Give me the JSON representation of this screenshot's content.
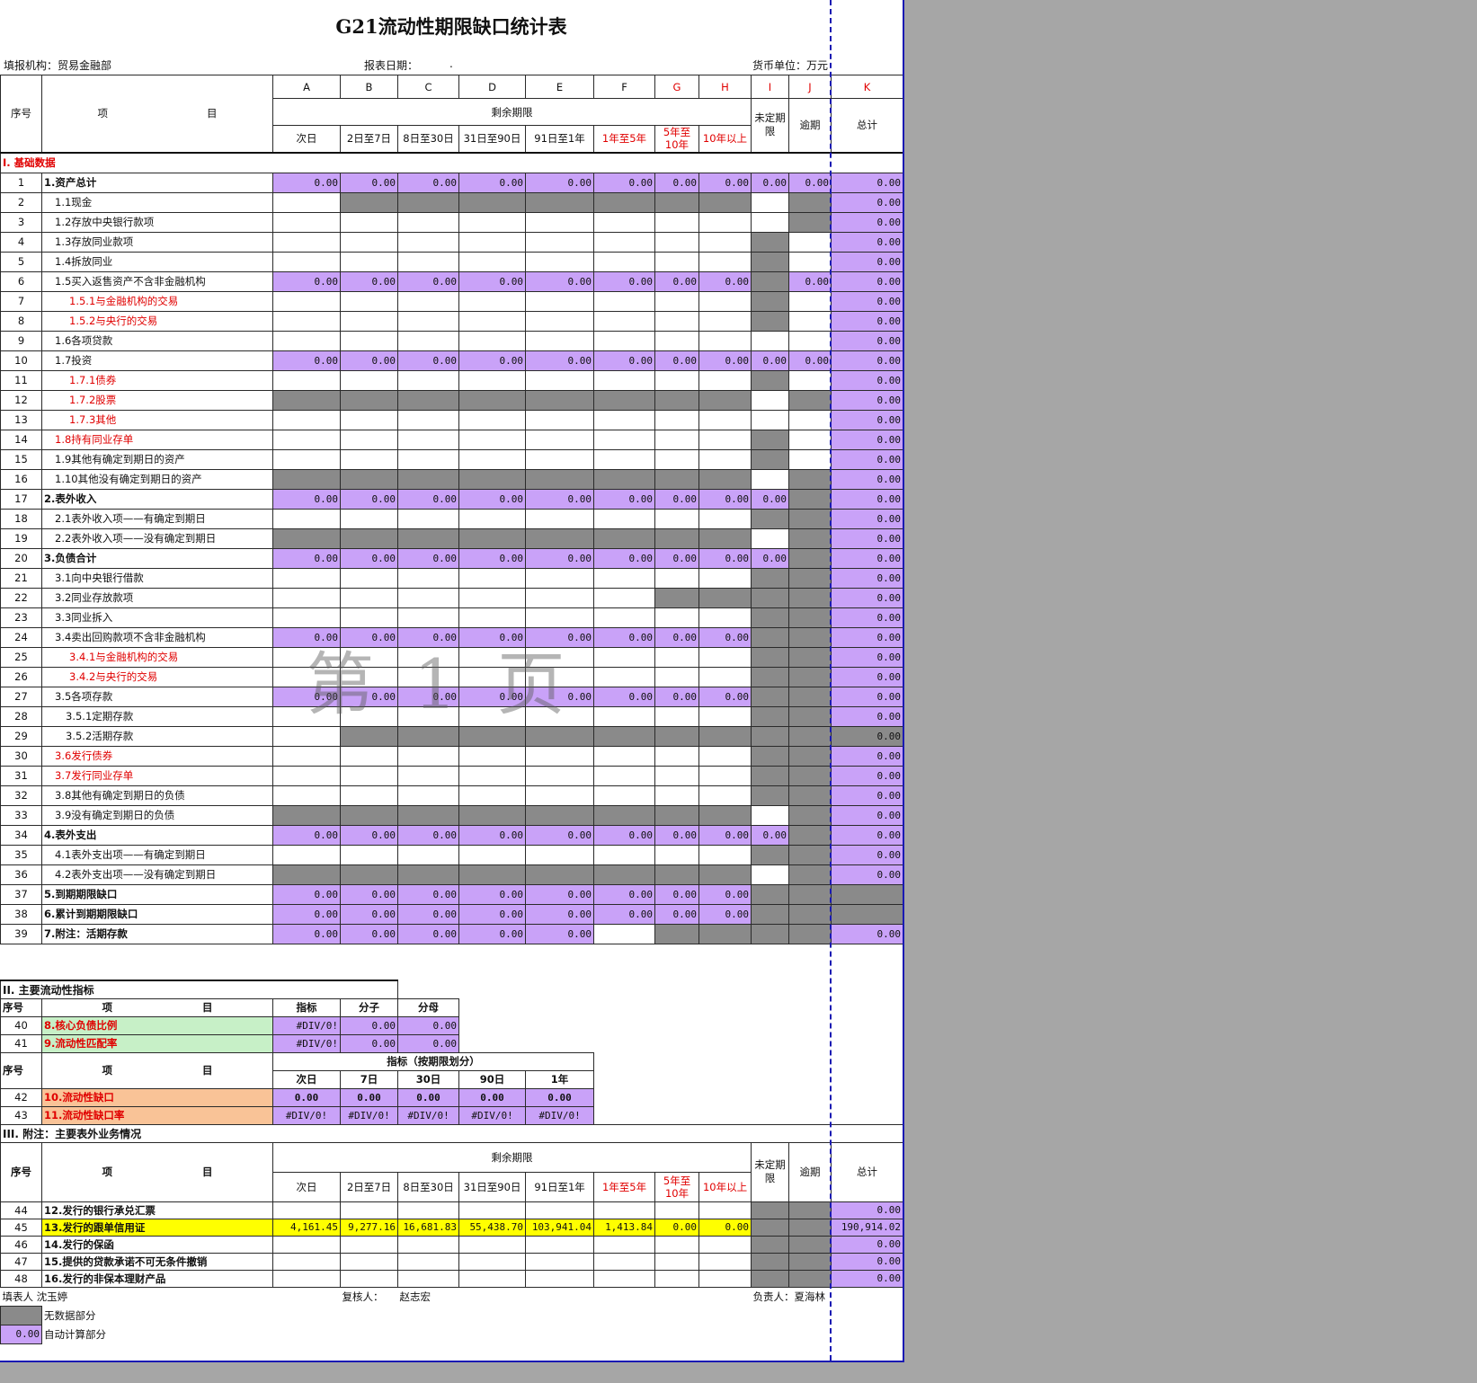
{
  "title": "G21流动性期限缺口统计表",
  "info": {
    "org_label": "填报机构：贸易金融部",
    "date_label": "报表日期：",
    "date_value": ".",
    "currency_label": "货币单位：万元"
  },
  "header": {
    "seq": "序号",
    "item_a": "项",
    "item_b": "目",
    "col_letters": [
      "A",
      "B",
      "C",
      "D",
      "E",
      "F",
      "G",
      "H",
      "I",
      "J",
      "K"
    ],
    "remaining": "剩余期限",
    "periods": [
      "次日",
      "2日至7日",
      "8日至30日",
      "31日至90日",
      "91日至1年",
      "1年至5年",
      "5年至10年",
      "10年以上"
    ],
    "undetermined": "未定期限",
    "overdue": "逾期",
    "total": "总计"
  },
  "section1": "I. 基础数据",
  "rows": [
    {
      "n": "1",
      "label": "1.资产总计",
      "style": "b",
      "fill": "pppppppppp",
      "vals": [
        "0.00",
        "0.00",
        "0.00",
        "0.00",
        "0.00",
        "0.00",
        "0.00",
        "0.00",
        "0.00",
        "0.00"
      ],
      "total": "0.00"
    },
    {
      "n": "2",
      "label": "1.1现金",
      "style": "i1",
      "fill": "wgggggggwg",
      "vals": [],
      "total": "0.00"
    },
    {
      "n": "3",
      "label": "1.2存放中央银行款项",
      "style": "i1",
      "fill": "wwwwwwwwwg",
      "vals": [],
      "total": "0.00"
    },
    {
      "n": "4",
      "label": "1.3存放同业款项",
      "style": "i1",
      "fill": "wwwwwwwwgw",
      "vals": [],
      "total": "0.00"
    },
    {
      "n": "5",
      "label": "1.4拆放同业",
      "style": "i1",
      "fill": "wwwwwwwwgw",
      "vals": [],
      "total": "0.00"
    },
    {
      "n": "6",
      "label": "1.5买入返售资产不含非金融机构",
      "style": "i1",
      "fill": "ppppppppgp",
      "vals": [
        "0.00",
        "0.00",
        "0.00",
        "0.00",
        "0.00",
        "0.00",
        "0.00",
        "0.00",
        "",
        "0.00"
      ],
      "total": "0.00"
    },
    {
      "n": "7",
      "label": "1.5.1与金融机构的交易",
      "style": "i2r",
      "fill": "wwwwwwwwgw",
      "vals": [],
      "total": "0.00"
    },
    {
      "n": "8",
      "label": "1.5.2与央行的交易",
      "style": "i2r",
      "fill": "wwwwwwwwgw",
      "vals": [],
      "total": "0.00"
    },
    {
      "n": "9",
      "label": "1.6各项贷款",
      "style": "i1",
      "fill": "wwwwwwwwww",
      "vals": [],
      "total": "0.00"
    },
    {
      "n": "10",
      "label": "1.7投资",
      "style": "i1",
      "fill": "pppppppppp",
      "vals": [
        "0.00",
        "0.00",
        "0.00",
        "0.00",
        "0.00",
        "0.00",
        "0.00",
        "0.00",
        "0.00",
        "0.00"
      ],
      "total": "0.00"
    },
    {
      "n": "11",
      "label": "1.7.1债券",
      "style": "i2r",
      "fill": "wwwwwwwwgw",
      "vals": [],
      "total": "0.00"
    },
    {
      "n": "12",
      "label": "1.7.2股票",
      "style": "i2r",
      "fill": "ggggggggwg",
      "vals": [],
      "total": "0.00"
    },
    {
      "n": "13",
      "label": "1.7.3其他",
      "style": "i2r",
      "fill": "wwwwwwwwww",
      "vals": [],
      "total": "0.00"
    },
    {
      "n": "14",
      "label": "1.8持有同业存单",
      "style": "i1r",
      "fill": "wwwwwwwwgw",
      "vals": [],
      "total": "0.00"
    },
    {
      "n": "15",
      "label": "1.9其他有确定到期日的资产",
      "style": "i1",
      "fill": "wwwwwwwwgw",
      "vals": [],
      "total": "0.00"
    },
    {
      "n": "16",
      "label": "1.10其他没有确定到期日的资产",
      "style": "i1",
      "fill": "ggggggggwg",
      "vals": [],
      "total": "0.00"
    },
    {
      "n": "17",
      "label": "2.表外收入",
      "style": "b",
      "fill": "pppppppppg",
      "vals": [
        "0.00",
        "0.00",
        "0.00",
        "0.00",
        "0.00",
        "0.00",
        "0.00",
        "0.00",
        "0.00",
        ""
      ],
      "total": "0.00"
    },
    {
      "n": "18",
      "label": "2.1表外收入项——有确定到期日",
      "style": "i1",
      "fill": "wwwwwwwwgg",
      "vals": [],
      "total": "0.00"
    },
    {
      "n": "19",
      "label": "2.2表外收入项——没有确定到期日",
      "style": "i1",
      "fill": "ggggggggwg",
      "vals": [],
      "total": "0.00"
    },
    {
      "n": "20",
      "label": "3.负债合计",
      "style": "b",
      "fill": "pppppppppg",
      "vals": [
        "0.00",
        "0.00",
        "0.00",
        "0.00",
        "0.00",
        "0.00",
        "0.00",
        "0.00",
        "0.00",
        ""
      ],
      "total": "0.00"
    },
    {
      "n": "21",
      "label": "3.1向中央银行借款",
      "style": "i1",
      "fill": "wwwwwwwwgg",
      "vals": [],
      "total": "0.00"
    },
    {
      "n": "22",
      "label": "3.2同业存放款项",
      "style": "i1",
      "fill": "wwwwwwgggg",
      "vals": [],
      "total": "0.00"
    },
    {
      "n": "23",
      "label": "3.3同业拆入",
      "style": "i1",
      "fill": "wwwwwwwwgg",
      "vals": [],
      "total": "0.00"
    },
    {
      "n": "24",
      "label": "3.4卖出回购款项不含非金融机构",
      "style": "i1",
      "fill": "ppppppppgg",
      "vals": [
        "0.00",
        "0.00",
        "0.00",
        "0.00",
        "0.00",
        "0.00",
        "0.00",
        "0.00",
        "",
        ""
      ],
      "total": "0.00"
    },
    {
      "n": "25",
      "label": "3.4.1与金融机构的交易",
      "style": "i2r",
      "fill": "wwwwwwwwgg",
      "vals": [],
      "total": "0.00"
    },
    {
      "n": "26",
      "label": "3.4.2与央行的交易",
      "style": "i2r",
      "fill": "wwwwwwwwgg",
      "vals": [],
      "total": "0.00"
    },
    {
      "n": "27",
      "label": "3.5各项存款",
      "style": "i1",
      "fill": "ppppppppgg",
      "vals": [
        "0.00",
        "0.00",
        "0.00",
        "0.00",
        "0.00",
        "0.00",
        "0.00",
        "0.00",
        "",
        ""
      ],
      "total": "0.00"
    },
    {
      "n": "28",
      "label": "3.5.1定期存款",
      "style": "i2",
      "fill": "wwwwwwwwgg",
      "vals": [],
      "total": "0.00"
    },
    {
      "n": "29",
      "label": "3.5.2活期存款",
      "style": "i2",
      "fill": "wgggggggggg",
      "vals": [],
      "total": "0.00"
    },
    {
      "n": "30",
      "label": "3.6发行债券",
      "style": "i1r",
      "fill": "wwwwwwwwgg",
      "vals": [],
      "total": "0.00"
    },
    {
      "n": "31",
      "label": "3.7发行同业存单",
      "style": "i1r",
      "fill": "wwwwwwwwgg",
      "vals": [],
      "total": "0.00"
    },
    {
      "n": "32",
      "label": "3.8其他有确定到期日的负债",
      "style": "i1",
      "fill": "wwwwwwwwgg",
      "vals": [],
      "total": "0.00"
    },
    {
      "n": "33",
      "label": "3.9没有确定到期日的负债",
      "style": "i1",
      "fill": "ggggggggwg",
      "vals": [],
      "total": "0.00"
    },
    {
      "n": "34",
      "label": "4.表外支出",
      "style": "b",
      "fill": "pppppppppg",
      "vals": [
        "0.00",
        "0.00",
        "0.00",
        "0.00",
        "0.00",
        "0.00",
        "0.00",
        "0.00",
        "0.00",
        ""
      ],
      "total": "0.00"
    },
    {
      "n": "35",
      "label": "4.1表外支出项——有确定到期日",
      "style": "i1",
      "fill": "wwwwwwwwgg",
      "vals": [],
      "total": "0.00"
    },
    {
      "n": "36",
      "label": "4.2表外支出项——没有确定到期日",
      "style": "i1",
      "fill": "ggggggggwg",
      "vals": [],
      "total": "0.00"
    },
    {
      "n": "37",
      "label": "5.到期期限缺口",
      "style": "b",
      "fill": "ppppppppggg",
      "vals": [
        "0.00",
        "0.00",
        "0.00",
        "0.00",
        "0.00",
        "0.00",
        "0.00",
        "0.00",
        "",
        ""
      ],
      "total": ""
    },
    {
      "n": "38",
      "label": "6.累计到期期限缺口",
      "style": "b",
      "fill": "ppppppppggg",
      "vals": [
        "0.00",
        "0.00",
        "0.00",
        "0.00",
        "0.00",
        "0.00",
        "0.00",
        "0.00",
        "",
        ""
      ],
      "total": ""
    },
    {
      "n": "39",
      "label": "7.附注：活期存款",
      "style": "b",
      "fill": "pppppwgggg",
      "vals": [
        "0.00",
        "0.00",
        "0.00",
        "0.00",
        "0.00",
        "",
        "",
        "",
        "",
        ""
      ],
      "total": "0.00"
    }
  ],
  "section2": "II. 主要流动性指标",
  "indicators": {
    "head": [
      "序号",
      "项",
      "目",
      "指标",
      "分子",
      "分母"
    ],
    "rows": [
      {
        "n": "40",
        "label": "8.核心负债比例",
        "vals": [
          "#DIV/0!",
          "0.00",
          "0.00"
        ]
      },
      {
        "n": "41",
        "label": "9.流动性匹配率",
        "vals": [
          "#DIV/0!",
          "0.00",
          "0.00"
        ]
      }
    ]
  },
  "gap": {
    "seq": "序号",
    "item_a": "项",
    "item_b": "目",
    "group": "指标（按期限划分）",
    "cols": [
      "次日",
      "7日",
      "30日",
      "90日",
      "1年"
    ],
    "rows": [
      {
        "n": "42",
        "label": "10.流动性缺口",
        "vals": [
          "0.00",
          "0.00",
          "0.00",
          "0.00",
          "0.00"
        ]
      },
      {
        "n": "43",
        "label": "11.流动性缺口率",
        "vals": [
          "#DIV/0!",
          "#DIV/0!",
          "#DIV/0!",
          "#DIV/0!",
          "#DIV/0!"
        ]
      }
    ]
  },
  "section3": "III. 附注：主要表外业务情况",
  "offbal": [
    {
      "n": "44",
      "label": "12.发行的银行承兑汇票",
      "hl": "",
      "vals": [],
      "total": "0.00"
    },
    {
      "n": "45",
      "label": "13.发行的跟单信用证",
      "hl": "yel",
      "vals": [
        "4,161.45",
        "9,277.16",
        "16,681.83",
        "55,438.70",
        "103,941.04",
        "1,413.84",
        "0.00",
        "0.00"
      ],
      "total": "190,914.02"
    },
    {
      "n": "46",
      "label": "14.发行的保函",
      "hl": "",
      "vals": [],
      "total": "0.00"
    },
    {
      "n": "47",
      "label": "15.提供的贷款承诺不可无条件撤销",
      "hl": "",
      "vals": [],
      "total": "0.00"
    },
    {
      "n": "48",
      "label": "16.发行的非保本理财产品",
      "hl": "",
      "vals": [],
      "total": "0.00"
    }
  ],
  "footer": {
    "preparer": "填表人 沈玉婷",
    "reviewer_label": "复核人：",
    "reviewer": "赵志宏",
    "manager": "负责人：夏海林",
    "legend_gray": "无数据部分",
    "legend_auto_val": "0.00",
    "legend_auto": "自动计算部分"
  },
  "watermark": "第 1 页",
  "colors": {
    "purple": "#c9a2f8",
    "gray": "#8a8a8a",
    "green": "#c7f0c7",
    "orange": "#f9c397",
    "yellow": "#ffff00",
    "red": "#e00000",
    "border_blue": "#1a1ab3"
  }
}
